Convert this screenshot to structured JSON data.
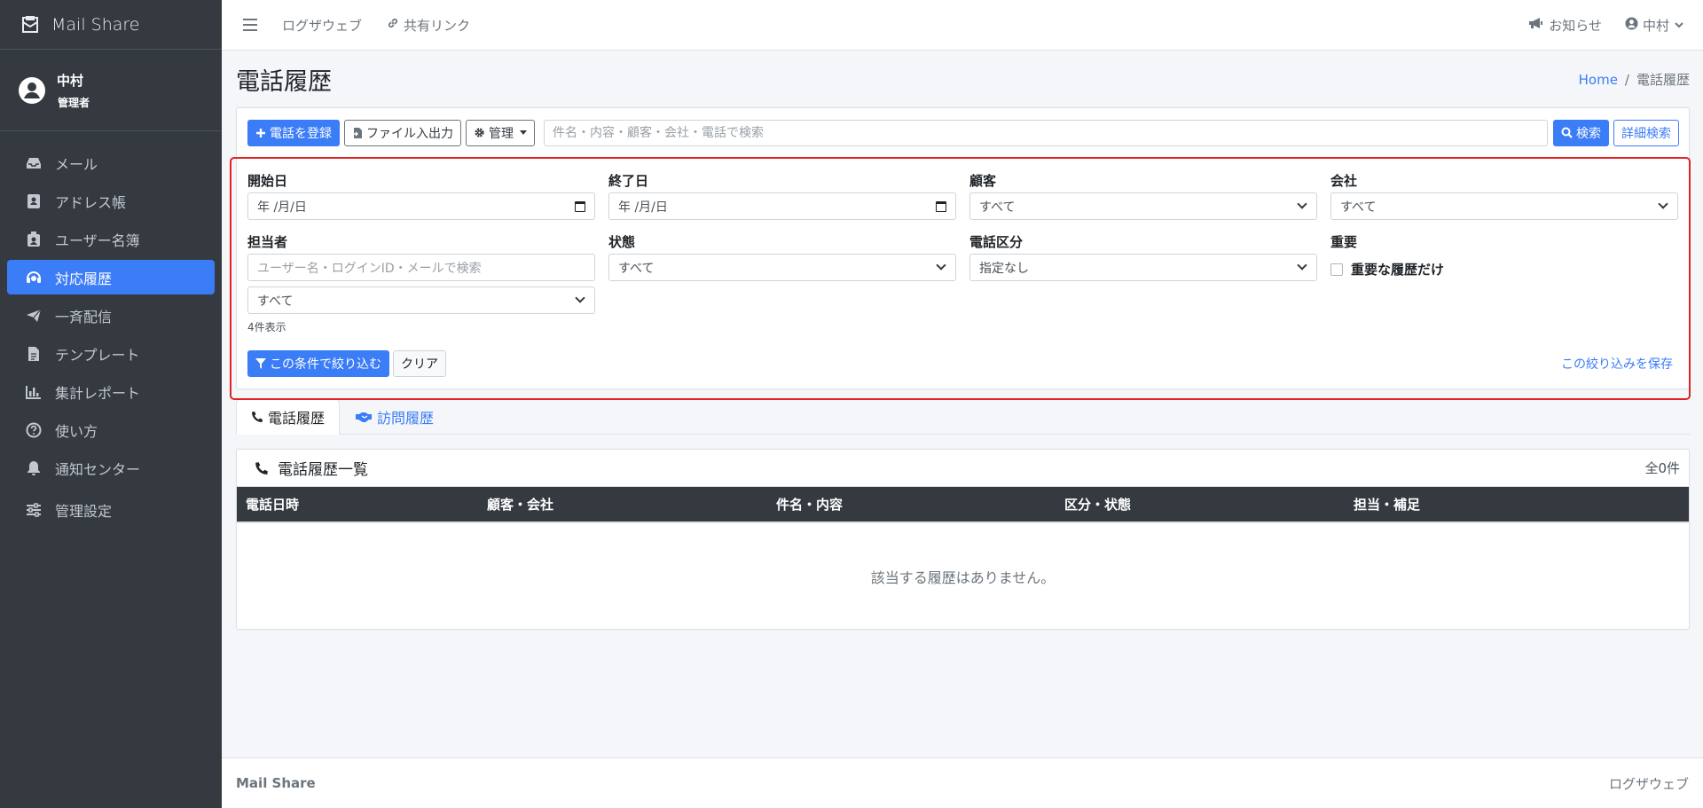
{
  "app": {
    "brand": "Mail Share"
  },
  "user": {
    "name": "中村",
    "role": "管理者"
  },
  "sidebar": {
    "items": [
      {
        "label": "メール",
        "icon": "inbox-icon"
      },
      {
        "label": "アドレス帳",
        "icon": "address-book-icon"
      },
      {
        "label": "ユーザー名簿",
        "icon": "id-badge-icon"
      },
      {
        "label": "対応履歴",
        "icon": "headset-icon",
        "active": true
      },
      {
        "label": "一斉配信",
        "icon": "paper-plane-icon"
      },
      {
        "label": "テンプレート",
        "icon": "file-text-icon"
      },
      {
        "label": "集計レポート",
        "icon": "bar-chart-icon"
      },
      {
        "label": "使い方",
        "icon": "question-circle-icon"
      },
      {
        "label": "通知センター",
        "icon": "bell-icon"
      },
      {
        "label": "管理設定",
        "icon": "sliders-icon"
      }
    ]
  },
  "topbar": {
    "link1": "ログザウェブ",
    "link2": "共有リンク",
    "notice": "お知らせ",
    "user": "中村"
  },
  "page": {
    "title": "電話履歴",
    "breadcrumb_home": "Home",
    "breadcrumb_current": "電話履歴"
  },
  "toolbar": {
    "register_label": "電話を登録",
    "file_io_label": "ファイル入出力",
    "manage_label": "管理",
    "search_placeholder": "件名・内容・顧客・会社・電話で検索",
    "search_label": "検索",
    "advanced_label": "詳細検索"
  },
  "filters": {
    "start_date": {
      "label": "開始日",
      "value": "年 /月/日"
    },
    "end_date": {
      "label": "終了日",
      "value": "年 /月/日"
    },
    "customer": {
      "label": "顧客",
      "value": "すべて"
    },
    "company": {
      "label": "会社",
      "value": "すべて"
    },
    "assignee": {
      "label": "担当者",
      "placeholder": "ユーザー名・ログインID・メールで検索",
      "value": "すべて",
      "count_text": "4件表示"
    },
    "status": {
      "label": "状態",
      "value": "すべて"
    },
    "call_type": {
      "label": "電話区分",
      "value": "指定なし"
    },
    "important": {
      "label": "重要",
      "checkbox_label": "重要な履歴だけ",
      "checked": false
    },
    "apply_label": "この条件で絞り込む",
    "clear_label": "クリア",
    "save_label": "この絞り込みを保存"
  },
  "tabs": [
    {
      "label": "電話履歴",
      "active": true
    },
    {
      "label": "訪問履歴",
      "active": false
    }
  ],
  "list": {
    "title": "電話履歴一覧",
    "count": "全0件",
    "columns": [
      "電話日時",
      "顧客・会社",
      "件名・内容",
      "区分・状態",
      "担当・補足"
    ],
    "empty_message": "該当する履歴はありません。"
  },
  "footer": {
    "brand": "Mail Share",
    "right": "ログザウェブ"
  },
  "colors": {
    "primary": "#3b7cf7",
    "sidebar": "#343a40",
    "highlight_border": "#e02424"
  }
}
